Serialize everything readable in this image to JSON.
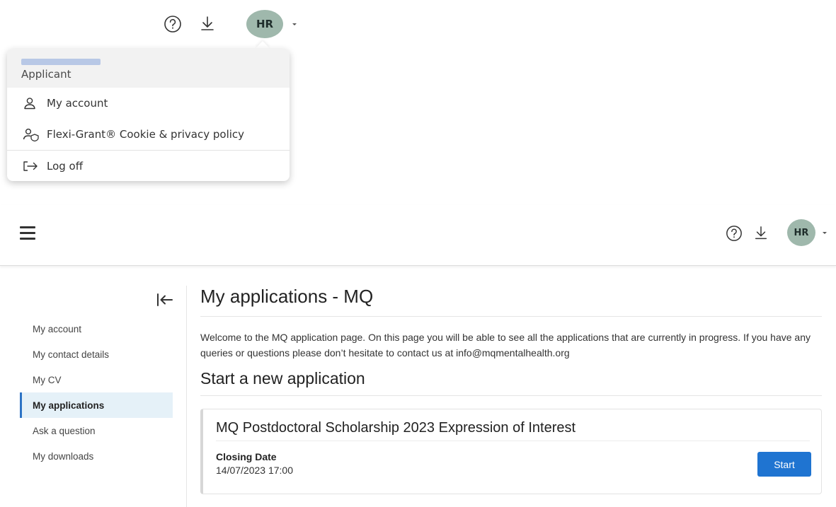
{
  "top_bar": {
    "avatar_initials": "HR"
  },
  "dropdown": {
    "role": "Applicant",
    "items": [
      {
        "label": "My account",
        "icon": "user-icon"
      },
      {
        "label": "Flexi-Grant® Cookie & privacy policy",
        "icon": "privacy-icon"
      },
      {
        "label": "Log off",
        "icon": "log-off-icon"
      }
    ]
  },
  "header": {
    "avatar_initials": "HR"
  },
  "sidebar": {
    "items": [
      {
        "label": "My account"
      },
      {
        "label": "My contact details"
      },
      {
        "label": "My CV"
      },
      {
        "label": "My applications",
        "active": true
      },
      {
        "label": "Ask a question"
      },
      {
        "label": "My downloads"
      }
    ]
  },
  "main": {
    "title": "My applications - MQ",
    "welcome": "Welcome to the MQ application page. On this page you will be able to see all the applications that are currently in progress. If you have any queries or questions please don’t hesitate to contact us at info@mqmentalhealth.org",
    "section_title": "Start a new application",
    "card": {
      "title": "MQ Postdoctoral Scholarship 2023 Expression of Interest",
      "closing_label": "Closing Date",
      "closing_date": "14/07/2023 17:00",
      "button_label": "Start"
    }
  },
  "colors": {
    "avatar_bg": "#9fb8ac",
    "primary_button": "#1f74d1",
    "active_nav_bg": "#e5f1f8",
    "active_nav_border": "#2d73c5"
  }
}
